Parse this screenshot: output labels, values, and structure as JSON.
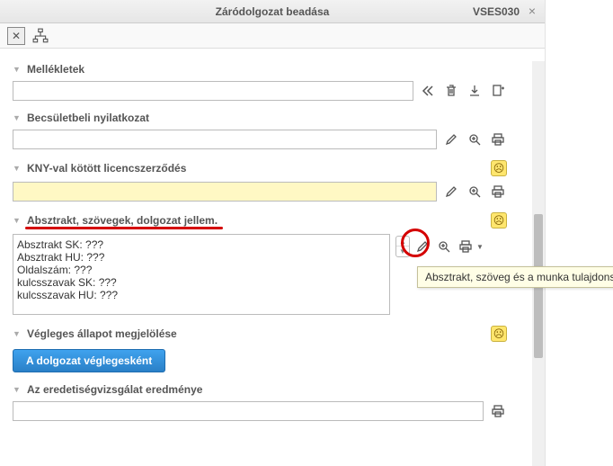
{
  "titlebar": {
    "title": "Záródolgozat beadása",
    "code": "VSES030"
  },
  "sections": {
    "attachments": {
      "label": "Mellékletek"
    },
    "honor": {
      "label": "Becsületbeli nyilatkozat"
    },
    "license": {
      "label": "KNY-val kötött licencszerződés"
    },
    "abstract": {
      "label": "Absztrakt, szövegek, dolgozat jellem.",
      "textarea": "Absztrakt SK: ???\nAbsztrakt HU: ???\nOldalszám: ???\nkulcsszavak SK: ???\nkulcsszavak HU: ???"
    },
    "final": {
      "label": "Végleges állapot megjelölése",
      "button": "A dolgozat véglegesként"
    },
    "originality": {
      "label": "Az eredetiségvizsgálat eredménye"
    }
  },
  "tooltip": "Absztrakt, szöveg és a munka tulajdonsága"
}
